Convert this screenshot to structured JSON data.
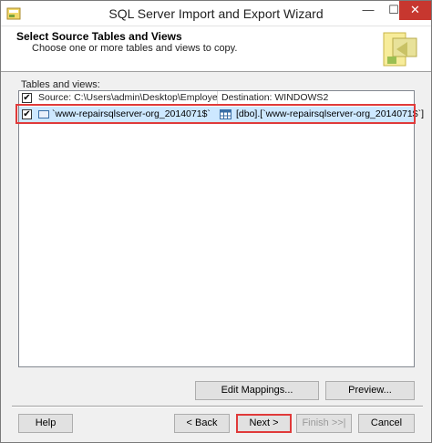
{
  "window": {
    "title": "SQL Server Import and Export Wizard",
    "minimize_glyph": "—",
    "maximize_glyph": "☐",
    "close_glyph": "✕"
  },
  "header": {
    "title": "Select Source Tables and Views",
    "subtitle": "Choose one or more tables and views to copy."
  },
  "tables": {
    "label": "Tables and views:",
    "columns": {
      "select_all_checked": true,
      "check_glyph": "✔",
      "source": "Source: C:\\Users\\admin\\Desktop\\Employee ...",
      "destination": "Destination: WINDOWS2"
    },
    "rows": [
      {
        "checked": true,
        "check_glyph": "✔",
        "source": "`www-repairsqlserver-org_2014071$`",
        "destination": "[dbo].[`www-repairsqlserver-org_2014071$`]"
      }
    ]
  },
  "buttons": {
    "edit_mappings": "Edit Mappings...",
    "preview": "Preview...",
    "help": "Help",
    "back": "< Back",
    "next": "Next >",
    "finish": "Finish >>|",
    "cancel": "Cancel"
  },
  "colors": {
    "highlight": "#e03a3a",
    "selected_row": "#cde8ff",
    "close_button": "#c7372f"
  }
}
